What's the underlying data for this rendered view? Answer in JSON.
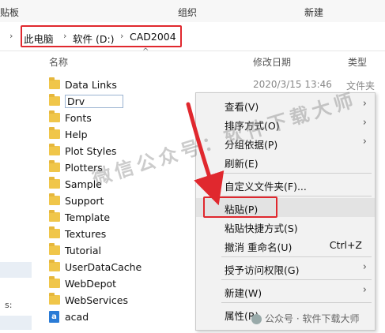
{
  "ribbon": {
    "clipboard": "贴板",
    "organize": "组织",
    "new": "新建"
  },
  "breadcrumb": [
    "此电脑",
    "软件 (D:)",
    "CAD2004"
  ],
  "columns": {
    "name": "名称",
    "date": "修改日期",
    "type": "类型"
  },
  "files": [
    {
      "name": "Data Links",
      "date": "2020/3/15 13:46",
      "type": "文件夹"
    },
    {
      "name": "Drv"
    },
    {
      "name": "Fonts"
    },
    {
      "name": "Help"
    },
    {
      "name": "Plot Styles"
    },
    {
      "name": "Plotters"
    },
    {
      "name": "Sample"
    },
    {
      "name": "Support"
    },
    {
      "name": "Template"
    },
    {
      "name": "Textures"
    },
    {
      "name": "Tutorial"
    },
    {
      "name": "UserDataCache"
    },
    {
      "name": "WebDepot"
    },
    {
      "name": "WebServices"
    },
    {
      "name": "acad",
      "icon_letter": "a"
    }
  ],
  "sidebar": {
    "partial": "s:"
  },
  "context_menu": {
    "view": "查看(V)",
    "sort": "排序方式(O)",
    "group": "分组依据(P)",
    "refresh": "刷新(E)",
    "customize": "自定义文件夹(F)...",
    "paste": "粘贴(P)",
    "paste_shortcut": "粘贴快捷方式(S)",
    "undo": "撤消 重命名(U)",
    "undo_shortcut": "Ctrl+Z",
    "grant_access": "授予访问权限(G)",
    "new": "新建(W)",
    "properties": "属性(R)"
  },
  "watermark": {
    "main": "微信公众号：软件下载大师",
    "footer": "公众号 · 软件下载大师"
  },
  "colors": {
    "highlight": "#e0282e",
    "folder": "#f0c64a"
  }
}
